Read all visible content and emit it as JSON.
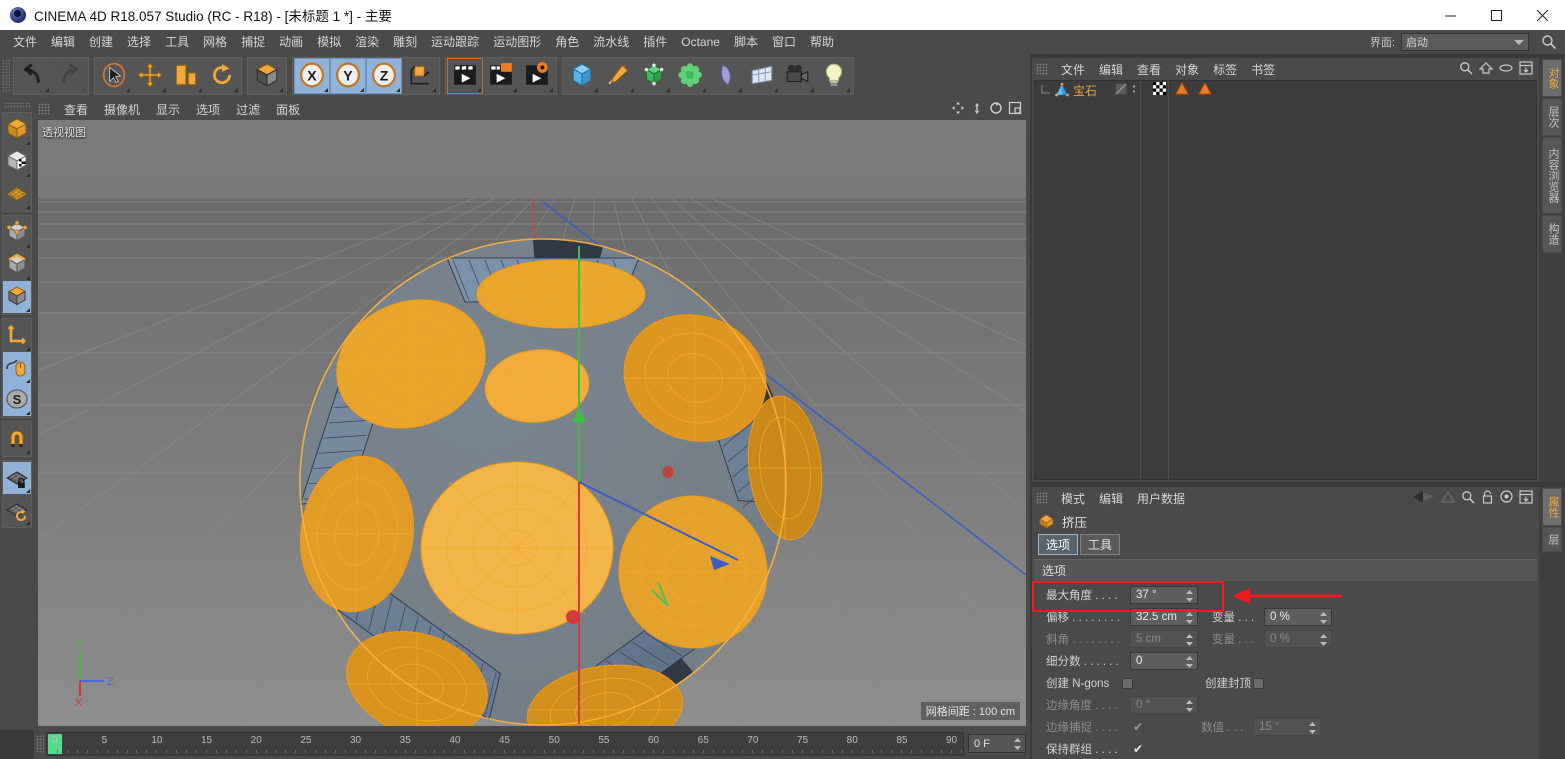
{
  "window": {
    "title": "CINEMA 4D R18.057 Studio (RC - R18) - [未标题 1 *] - 主要",
    "minimize": "—",
    "maximize": "▢",
    "close": "✕"
  },
  "menubar": {
    "items": [
      "文件",
      "编辑",
      "创建",
      "选择",
      "工具",
      "网格",
      "捕捉",
      "动画",
      "模拟",
      "渲染",
      "雕刻",
      "运动跟踪",
      "运动图形",
      "角色",
      "流水线",
      "插件",
      "Octane",
      "脚本",
      "窗口",
      "帮助"
    ]
  },
  "layout": {
    "label": "界面:",
    "value": "启动",
    "search_icon": "search-icon"
  },
  "toolbar": {
    "groups": [
      {
        "name": "history",
        "buttons": [
          {
            "name": "undo-button",
            "icon": "undo-icon",
            "state": "normal"
          },
          {
            "name": "redo-button",
            "icon": "redo-icon",
            "state": "disabled"
          }
        ]
      },
      {
        "name": "transform",
        "buttons": [
          {
            "name": "select-tool",
            "icon": "live-selection-icon",
            "state": "normal"
          },
          {
            "name": "move-tool",
            "icon": "move-icon",
            "state": "normal"
          },
          {
            "name": "scale-tool",
            "icon": "scale-icon",
            "state": "normal"
          },
          {
            "name": "rotate-tool",
            "icon": "rotate-icon",
            "state": "normal"
          }
        ]
      },
      {
        "name": "coordinate-system",
        "buttons": [
          {
            "name": "world-object-toggle",
            "icon": "world-axis-icon",
            "state": "normal"
          }
        ]
      },
      {
        "name": "axis-locks",
        "buttons": [
          {
            "name": "lock-x-axis",
            "icon": "x-axis-icon",
            "state": "selected"
          },
          {
            "name": "lock-y-axis",
            "icon": "y-axis-icon",
            "state": "selected"
          },
          {
            "name": "lock-z-axis",
            "icon": "z-axis-icon",
            "state": "selected"
          },
          {
            "name": "object-axis-toggle",
            "icon": "object-axis-icon",
            "state": "normal"
          }
        ]
      },
      {
        "name": "render",
        "buttons": [
          {
            "name": "render-view-button",
            "icon": "render-view-icon",
            "state": "active"
          },
          {
            "name": "render-to-picture-viewer-button",
            "icon": "render-picture-icon",
            "state": "normal"
          },
          {
            "name": "render-settings-button",
            "icon": "render-settings-icon",
            "state": "normal"
          }
        ]
      },
      {
        "name": "creation",
        "buttons": [
          {
            "name": "add-primitive-button",
            "icon": "cube-primitive-icon",
            "state": "normal"
          },
          {
            "name": "add-spline-button",
            "icon": "pen-spline-icon",
            "state": "normal"
          },
          {
            "name": "add-generator-button",
            "icon": "generator-icon",
            "state": "normal"
          },
          {
            "name": "add-deformer-button",
            "icon": "deformer-icon",
            "state": "normal"
          },
          {
            "name": "add-scene-object-button",
            "icon": "scene-object-icon",
            "state": "normal"
          },
          {
            "name": "add-environment-button",
            "icon": "environment-icon",
            "state": "normal"
          },
          {
            "name": "add-camera-button",
            "icon": "camera-icon",
            "state": "normal"
          },
          {
            "name": "add-light-button",
            "icon": "light-bulb-icon",
            "state": "normal"
          }
        ]
      }
    ]
  },
  "lefttoolbar": {
    "groups": [
      {
        "buttons": [
          {
            "name": "make-editable-button",
            "icon": "editable-cube-icon",
            "state": "normal"
          },
          {
            "name": "texture-mode-button",
            "icon": "texture-cube-icon",
            "state": "normal"
          },
          {
            "name": "viewport-solo-button",
            "icon": "grid-plane-icon",
            "state": "normal"
          }
        ]
      },
      {
        "buttons": [
          {
            "name": "points-mode-button",
            "icon": "points-mode-icon",
            "state": "normal"
          },
          {
            "name": "edges-mode-button",
            "icon": "edges-mode-icon",
            "state": "normal"
          },
          {
            "name": "polygons-mode-button",
            "icon": "polygons-mode-icon",
            "state": "selected"
          }
        ]
      },
      {
        "buttons": [
          {
            "name": "axis-mode-button",
            "icon": "axis-icon",
            "state": "normal"
          },
          {
            "name": "enable-tweak-button",
            "icon": "mouse-tweak-icon",
            "state": "selected"
          },
          {
            "name": "soft-selection-button",
            "icon": "s-soft-selection-icon",
            "state": "selected"
          }
        ]
      },
      {
        "buttons": [
          {
            "name": "snap-button",
            "icon": "magnet-snap-icon",
            "state": "normal"
          }
        ]
      },
      {
        "buttons": [
          {
            "name": "lock-workplane-button",
            "icon": "locked-workplane-icon",
            "state": "selected"
          },
          {
            "name": "workplane-rotate-button",
            "icon": "workplane-rotate-icon",
            "state": "normal"
          }
        ]
      }
    ]
  },
  "viewport": {
    "menus": [
      "查看",
      "摄像机",
      "显示",
      "选项",
      "过滤",
      "面板"
    ],
    "label": "透视视图",
    "grid_note": "网格间距 : 100 cm",
    "axis": {
      "x": "X",
      "y": "Y",
      "z": "Z"
    },
    "icons": [
      "move-viewport-icon",
      "zoom-viewport-icon",
      "rotate-viewport-icon",
      "maximize-viewport-icon"
    ]
  },
  "timeline": {
    "ticks": [
      "0",
      "5",
      "10",
      "15",
      "20",
      "25",
      "30",
      "35",
      "40",
      "45",
      "50",
      "55",
      "60",
      "65",
      "70",
      "75",
      "80",
      "85",
      "90"
    ],
    "current_frame": "0 F",
    "playhead_frame": 0
  },
  "object_manager": {
    "menus": [
      "文件",
      "编辑",
      "查看",
      "对象",
      "标签",
      "书签"
    ],
    "header_icons": [
      "search-icon",
      "home-icon",
      "ellipse-icon",
      "layout-icon"
    ],
    "objects": [
      {
        "name": "宝石",
        "icon": "gemstone-object-icon",
        "tags": [
          "checker-tag-icon",
          "phong-tag-icon",
          "phong-tag-icon"
        ]
      }
    ]
  },
  "attribute_manager": {
    "menus": [
      "模式",
      "编辑",
      "用户数据"
    ],
    "header_icons": [
      "back-arrow-icon",
      "forward-arrow-icon",
      "up-arrow-icon",
      "search-icon",
      "lock-icon",
      "target-icon",
      "layout-icon"
    ],
    "title": "挤压",
    "title_icon": "extrude-object-icon",
    "tabs": [
      {
        "label": "选项",
        "active": true
      },
      {
        "label": "工具",
        "active": false
      }
    ],
    "section": "选项",
    "fields": [
      {
        "label": "最大角度 . . . .",
        "value": "37 °",
        "disabled": false,
        "highlighted": true,
        "label2": "",
        "value2": "",
        "disabled2": false
      },
      {
        "label": "偏移 . . . . . . . .",
        "value": "32.5 cm",
        "disabled": false,
        "highlighted": false,
        "label2": "变量 . . .",
        "value2": "0 %",
        "disabled2": false
      },
      {
        "label": "斜角 . . . . . . . .",
        "value": "5 cm",
        "disabled": true,
        "highlighted": false,
        "label2": "变量 . . .",
        "value2": "0 %",
        "disabled2": true
      },
      {
        "label": "细分数 . . . . . .",
        "value": "0",
        "disabled": false,
        "highlighted": false,
        "label2": "",
        "value2": "",
        "disabled2": false
      }
    ],
    "checkrows": [
      {
        "label": "创建 N-gons",
        "checked": false,
        "label2": "创建封顶",
        "checked2": false
      }
    ],
    "fields2": [
      {
        "label": "边缘角度 . . . .",
        "value": "0 °",
        "disabled": true,
        "label2": "",
        "value2": "",
        "disabled2": false
      }
    ],
    "markrows": [
      {
        "label": "边缘捕捉 . . . .",
        "mark": "✔",
        "dim": true,
        "label2": "数值 . . .",
        "value2": "15 °",
        "disabled2": true
      },
      {
        "label": "保持群组 . . . .",
        "mark": "✔",
        "dim": false,
        "label2": "",
        "value2": "",
        "disabled2": false
      }
    ],
    "annotation": {
      "shape": "red-rectangle",
      "arrow": "red-left-arrow",
      "color": "#ee1c1c"
    }
  },
  "side_tabs_top": [
    {
      "label": "对象",
      "active": true
    },
    {
      "label": "层次",
      "active": false
    },
    {
      "label": "内容浏览器",
      "active": false
    },
    {
      "label": "构造",
      "active": false
    }
  ],
  "side_tabs_bottom": [
    {
      "label": "属性",
      "active": true
    },
    {
      "label": "层",
      "active": false
    }
  ],
  "colors": {
    "accent_orange": "#e8a33c",
    "selection_blue": "#8fb2d6",
    "panel_bg": "#4a4a4a",
    "field_bg": "#5e5e5e",
    "annotation_red": "#ee1c1c",
    "playhead_green": "#57d98a"
  }
}
